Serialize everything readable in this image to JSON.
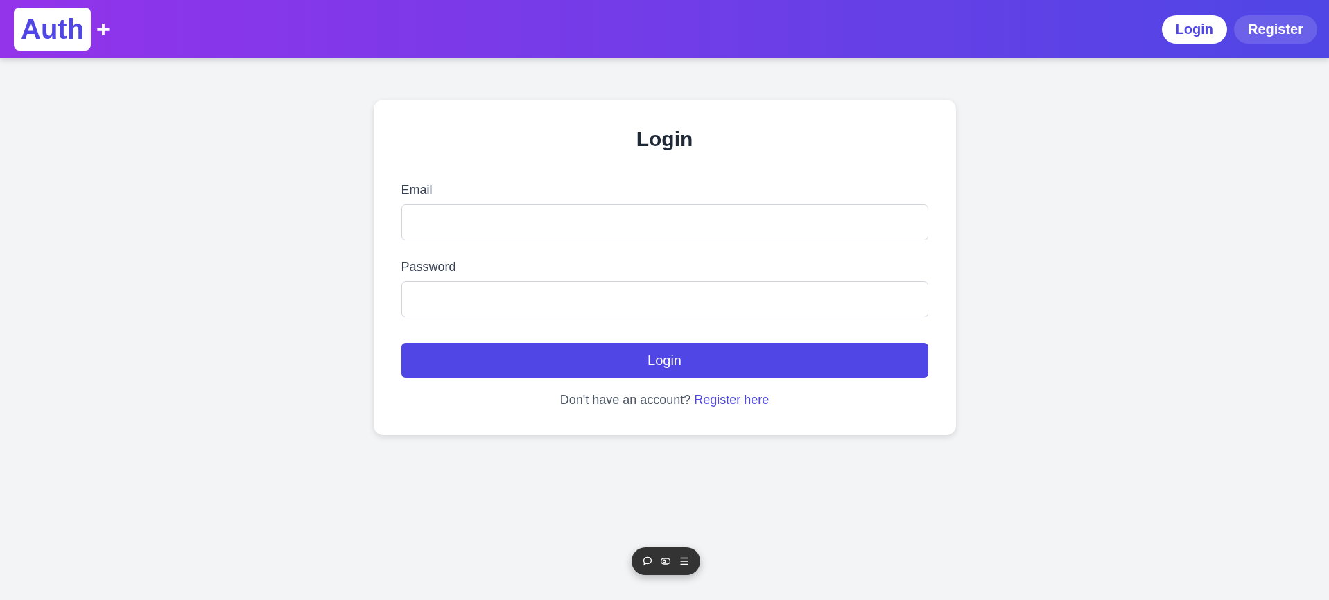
{
  "header": {
    "logo": "Auth",
    "logo_mark": "+",
    "nav": [
      {
        "label": "Login",
        "selected": true
      },
      {
        "label": "Register",
        "selected": false
      }
    ]
  },
  "form": {
    "title": "Login",
    "fields": [
      {
        "label": "Email"
      },
      {
        "label": "Password"
      }
    ],
    "submit": "Login",
    "footer_text": "Don't have an account?",
    "footer_link": "Register here"
  }
}
